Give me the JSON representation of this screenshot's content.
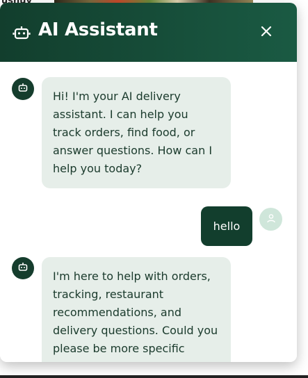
{
  "background": {
    "text": "ushuy"
  },
  "header": {
    "title": "AI Assistant",
    "bot_icon": "robot-icon",
    "close_icon": "close-icon"
  },
  "messages": [
    {
      "sender": "bot",
      "avatar_icon": "robot-icon",
      "text": "Hi! I'm your AI delivery assistant. I can help you track orders, find food, or answer questions. How can I help you today?"
    },
    {
      "sender": "user",
      "avatar_icon": "user-icon",
      "text": "hello"
    },
    {
      "sender": "bot",
      "avatar_icon": "robot-icon",
      "text": "I'm here to help with orders, tracking, restaurant recommendations, and delivery questions. Could you please be more specific about what you need"
    }
  ],
  "colors": {
    "header": "#123e2d",
    "bot_bubble": "#e6eee9",
    "user_bubble": "#123e2d",
    "user_avatar": "#cfe6da"
  }
}
